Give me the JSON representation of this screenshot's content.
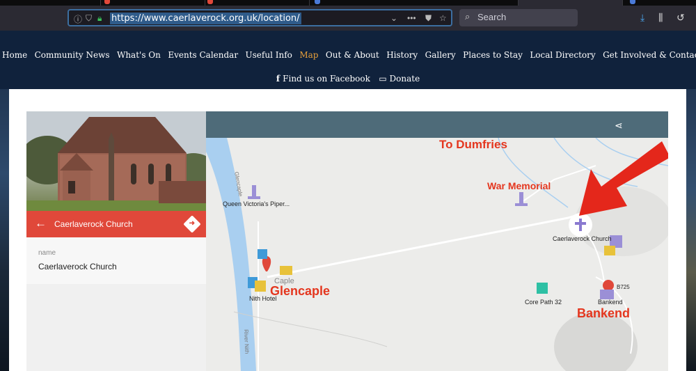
{
  "browser": {
    "url": "https://www.caerlaverock.org.uk/location/",
    "search_placeholder": "Search",
    "url_icons": [
      "info-icon",
      "shield-icon",
      "lock-icon"
    ],
    "toolbar_icons": [
      "download-icon",
      "library-icon",
      "history-icon"
    ]
  },
  "nav": {
    "items": [
      "Home",
      "Community News",
      "What's On",
      "Events Calendar",
      "Useful Info",
      "Map",
      "Out & About",
      "History",
      "Gallery",
      "Places to Stay",
      "Local Directory",
      "Get Involved & Contact"
    ],
    "active": "Map",
    "facebook": "Find us on Facebook",
    "donate": "Donate"
  },
  "place": {
    "title": "Caerlaverock Church",
    "field_label": "name",
    "field_value": "Caerlaverock Church"
  },
  "map": {
    "overlay_labels": {
      "dumfries": "To Dumfries",
      "war_memorial": "War Memorial",
      "glencaple": "Glencaple",
      "bankend": "Bankend"
    },
    "poi_labels": {
      "piper": "Queen Victoria's Piper...",
      "church": "Caerlaverock Church",
      "nith_hotel": "Nith Hotel",
      "core_path": "Core Path 32",
      "bankend_small": "Bankend",
      "road": "B725",
      "glencaple_street": "Glencaple",
      "river": "River Nith",
      "glencaple_town": "Caple"
    },
    "colors": {
      "arrow": "#e4271b",
      "water": "#a9cff0",
      "header": "#4e6b79"
    }
  }
}
